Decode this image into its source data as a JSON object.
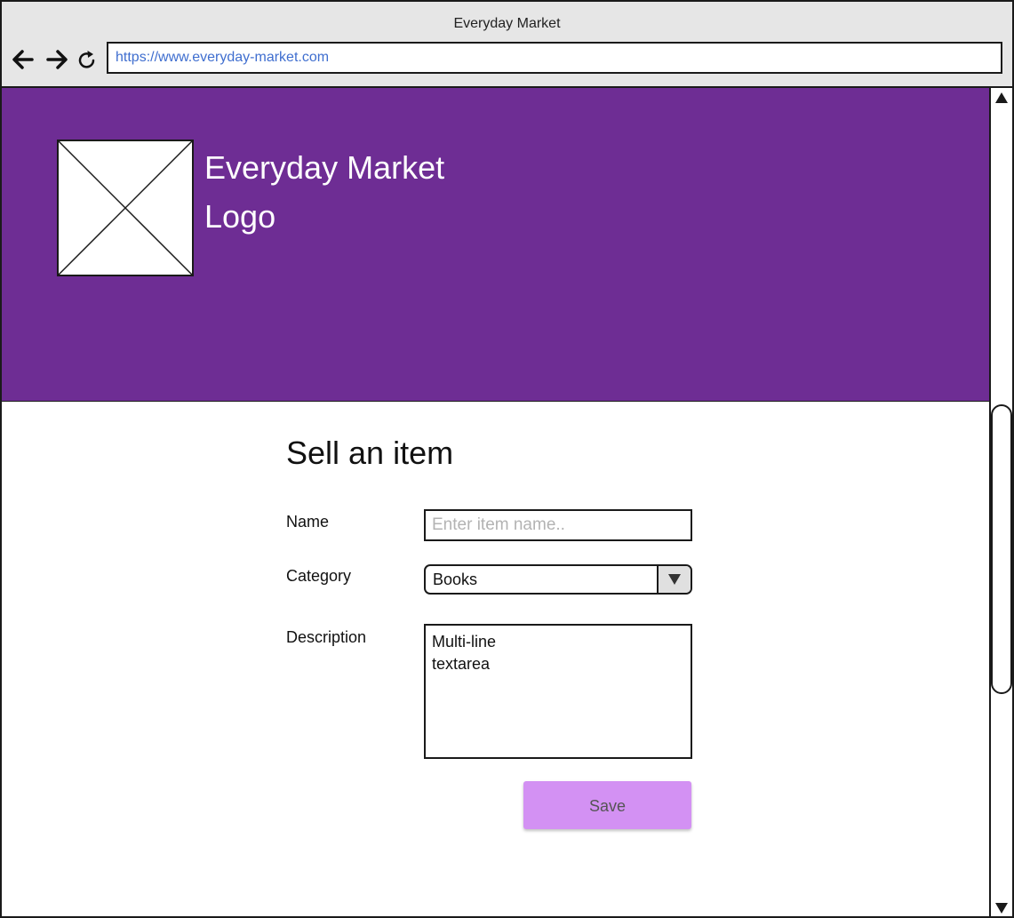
{
  "window": {
    "title": "Everyday Market"
  },
  "browser": {
    "back_icon": "arrow-left-icon",
    "forward_icon": "arrow-right-icon",
    "reload_icon": "reload-icon",
    "url": "https://www.everyday-market.com"
  },
  "header": {
    "background_color": "#6E2D94",
    "logo_icon": "image-placeholder-icon",
    "logo_text": "Everyday Market\nLogo"
  },
  "form": {
    "title": "Sell an item",
    "name_label": "Name",
    "name_placeholder": "Enter item name..",
    "name_value": "",
    "category_label": "Category",
    "category_value": "Books",
    "description_label": "Description",
    "description_value": "Multi-line\ntextarea",
    "save_label": "Save",
    "save_color": "#D391F3"
  },
  "scrollbar": {
    "up_icon": "scroll-up-icon",
    "down_icon": "scroll-down-icon"
  }
}
